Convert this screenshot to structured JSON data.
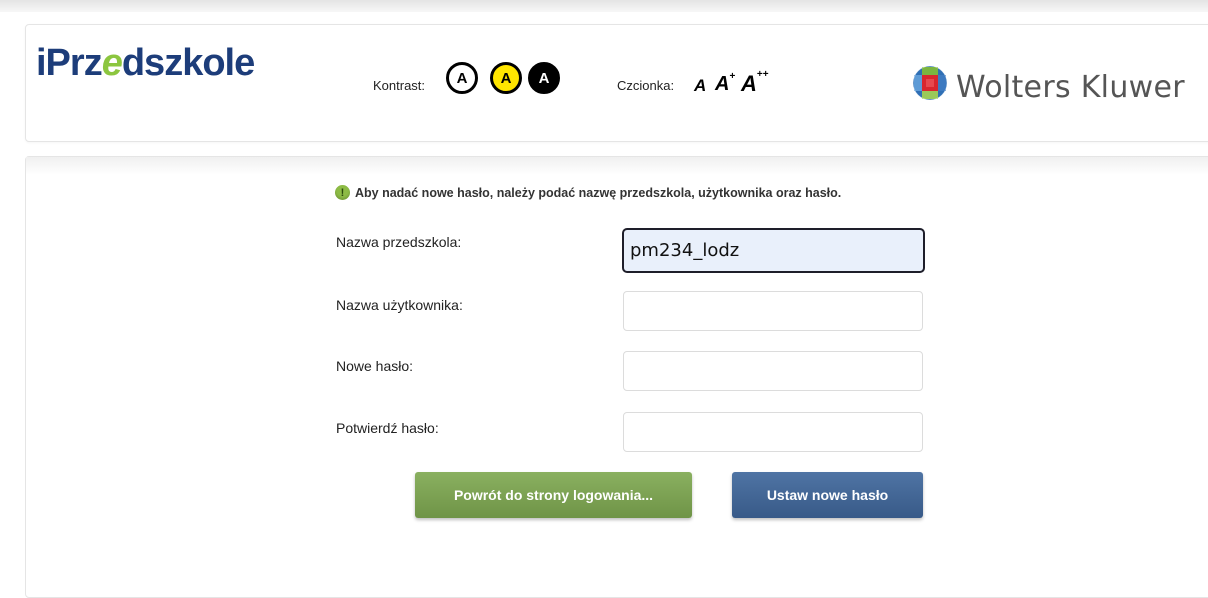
{
  "header": {
    "logo": {
      "prefix": "iPrz",
      "accent": "e",
      "suffix": "dszkole"
    },
    "contrast_label": "Kontrast:",
    "contrast_options": [
      "A",
      "A",
      "A"
    ],
    "font_label": "Czcionka:",
    "font_options": [
      {
        "base": "A",
        "sup": ""
      },
      {
        "base": "A",
        "sup": "+"
      },
      {
        "base": "A",
        "sup": "++"
      }
    ],
    "brand": "Wolters Kluwer",
    "brand_icon": "wolters-kluwer-logo"
  },
  "form": {
    "info_icon": "info-icon",
    "info_text": "Aby nadać nowe hasło, należy podać nazwę przedszkola, użytkownika oraz hasło.",
    "fields": [
      {
        "label": "Nazwa przedszkola:",
        "value": "pm234_lodz",
        "placeholder": ""
      },
      {
        "label": "Nazwa użytkownika:",
        "value": "",
        "placeholder": ""
      },
      {
        "label": "Nowe hasło:",
        "value": "",
        "placeholder": ""
      },
      {
        "label": "Potwierdź hasło:",
        "value": "",
        "placeholder": ""
      }
    ],
    "back_button": "Powrót do strony logowania...",
    "submit_button": "Ustaw nowe hasło"
  },
  "colors": {
    "logo": "#1d3d7a",
    "logo_accent": "#8cc63f",
    "back_button": "#7aa052",
    "submit_button": "#426696",
    "contrast_yellow": "#ffe500"
  }
}
